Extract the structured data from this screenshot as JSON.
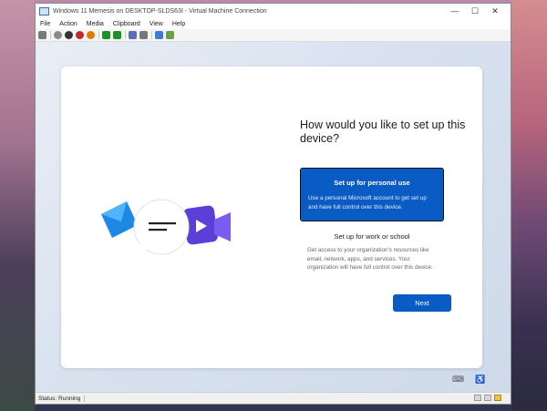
{
  "window": {
    "title": "Windows 11 Memesis on DESKTOP-SLDS63I - Virtual Machine Connection",
    "controls": {
      "minimize": "—",
      "maximize": "☐",
      "close": "✕"
    }
  },
  "menu": [
    "File",
    "Action",
    "Media",
    "Clipboard",
    "View",
    "Help"
  ],
  "toolbar": {
    "buttons": [
      {
        "name": "ctrl-alt-del-icon",
        "color": "#7a7a7a"
      },
      {
        "name": "start-icon",
        "color": "#8a8a8a"
      },
      {
        "name": "turn-off-icon",
        "color": "#333333"
      },
      {
        "name": "shut-down-icon",
        "color": "#c62828"
      },
      {
        "name": "save-icon",
        "color": "#e07b00"
      },
      {
        "name": "pause-icon",
        "color": "#1f8f2a"
      },
      {
        "name": "reset-icon",
        "color": "#1f8f2a"
      },
      {
        "name": "checkpoint-icon",
        "color": "#5a6fb5"
      },
      {
        "name": "revert-icon",
        "color": "#777777"
      },
      {
        "name": "enhanced-session-icon",
        "color": "#3a7bd5"
      },
      {
        "name": "share-icon",
        "color": "#6aa04a"
      }
    ]
  },
  "oobe": {
    "heading": "How would you like to set up this device?",
    "option_personal": {
      "title": "Set up for personal use",
      "description": "Use a personal Microsoft account to get set up and have full control over this device."
    },
    "option_work": {
      "title": "Set up for work or school",
      "description": "Get access to your organization's resources like email, network, apps, and services. Your organization will have full control over this device."
    },
    "next_label": "Next"
  },
  "screen_icons": [
    "keyboard-icon",
    "accessibility-icon"
  ],
  "status": {
    "text": "Status: Running"
  },
  "colors": {
    "accent": "#0a5bc4",
    "mail_blue": "#1e88e5",
    "video_purple": "#5b3fd6"
  }
}
